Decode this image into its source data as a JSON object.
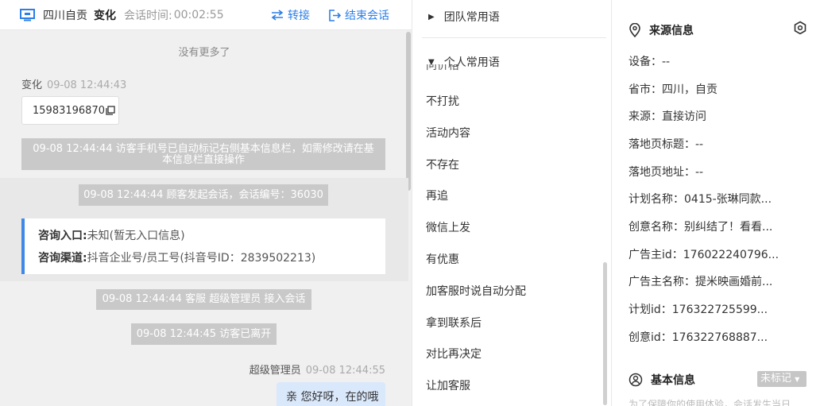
{
  "header": {
    "location": "四川自贡",
    "visitor": "变化",
    "time_label": "会话时间:",
    "time_value": "00:02:55",
    "transfer": "转接",
    "end": "结束会话"
  },
  "chat": {
    "no_more": "没有更多了",
    "visitor_name": "变化",
    "visitor_time": "09-08 12:44:43",
    "phone": "15983196870",
    "sys1": "09-08 12:44:44 访客手机号已自动标记右侧基本信息栏，如需修改请在基本信息栏直接操作",
    "sys2": "09-08 12:44:44 顾客发起会话，会话编号：36030",
    "entry_label": "咨询入口:",
    "entry_value": "未知(暂无入口信息)",
    "channel_label": "咨询渠道:",
    "channel_value": "抖音企业号/员工号(抖音号ID：2839502213)",
    "sys3": "09-08 12:44:44 客服 超级管理员 接入会话",
    "sys4": "09-08 12:44:45 访客已离开",
    "agent_name": "超级管理员",
    "agent_time": "09-08 12:44:55",
    "agent_msg": "亲 您好呀，在的哦"
  },
  "phrases": {
    "team_group": "团队常用语",
    "personal_group": "个人常用语",
    "clipped": "问价格",
    "items": [
      "不打扰",
      "活动内容",
      "不存在",
      "再追",
      "微信上发",
      "有优惠",
      "加客服时说自动分配",
      "拿到联系后",
      "对比再决定",
      "让加客服"
    ]
  },
  "info": {
    "source_title": "来源信息",
    "rows": [
      "设备：--",
      "省市：四川，自贡",
      "来源：直接访问",
      "落地页标题：--",
      "落地页地址：--",
      "计划名称：0415-张琳同款...",
      "创意名称：别纠结了！看看...",
      "广告主id：176022240796...",
      "广告主名称：提米映画婚前...",
      "计划id：176322725599...",
      "创意id：176322768887..."
    ],
    "basic_title": "基本信息",
    "tag": "未标记",
    "faded": "为了保障你的使用体验，会话发生当日"
  },
  "colors": {
    "accent": "#2c7fe8",
    "system_msg_bg": "#c9c9c9",
    "agent_bubble": "#dae8fb"
  }
}
